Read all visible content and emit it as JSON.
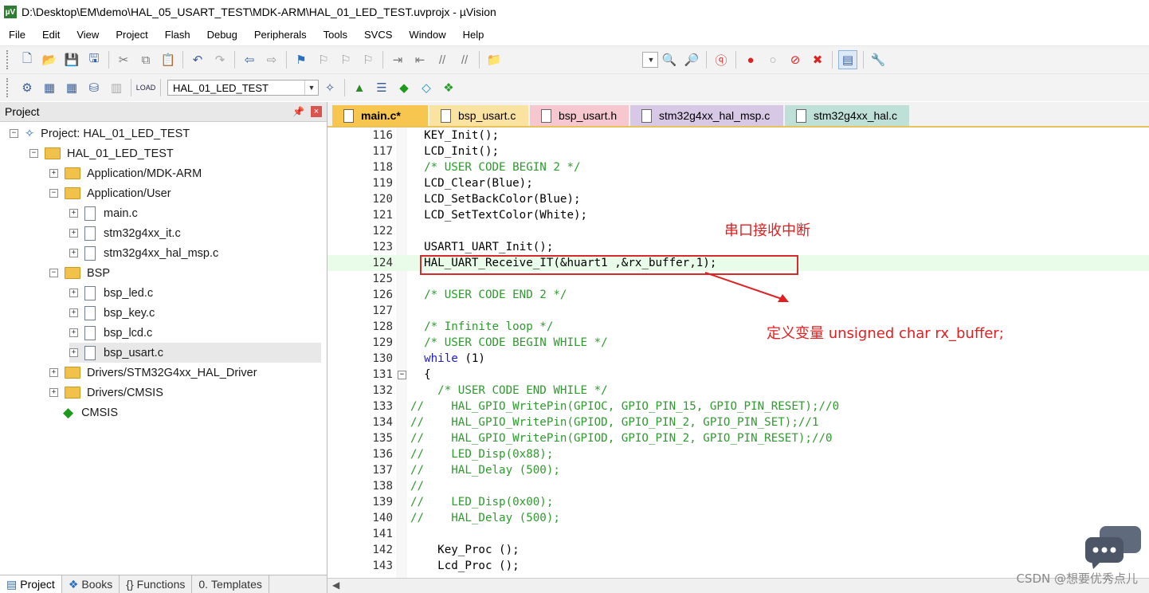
{
  "window": {
    "title": "D:\\Desktop\\EM\\demo\\HAL_05_USART_TEST\\MDK-ARM\\HAL_01_LED_TEST.uvprojx - µVision",
    "app_icon": "uv-logo-icon"
  },
  "menu": [
    "File",
    "Edit",
    "View",
    "Project",
    "Flash",
    "Debug",
    "Peripherals",
    "Tools",
    "SVCS",
    "Window",
    "Help"
  ],
  "toolbar2": {
    "target": "HAL_01_LED_TEST"
  },
  "project_panel": {
    "title": "Project",
    "tree": [
      {
        "label": "Project: HAL_01_LED_TEST",
        "level": 0,
        "expander": "−",
        "icon": "project-icon"
      },
      {
        "label": "HAL_01_LED_TEST",
        "level": 1,
        "expander": "−",
        "icon": "target-folder-icon"
      },
      {
        "label": "Application/MDK-ARM",
        "level": 2,
        "expander": "+",
        "icon": "folder-icon"
      },
      {
        "label": "Application/User",
        "level": 2,
        "expander": "−",
        "icon": "folder-icon"
      },
      {
        "label": "main.c",
        "level": 3,
        "expander": "+",
        "icon": "file-icon"
      },
      {
        "label": "stm32g4xx_it.c",
        "level": 3,
        "expander": "+",
        "icon": "file-icon"
      },
      {
        "label": "stm32g4xx_hal_msp.c",
        "level": 3,
        "expander": "+",
        "icon": "file-icon"
      },
      {
        "label": "BSP",
        "level": 2,
        "expander": "−",
        "icon": "folder-icon"
      },
      {
        "label": "bsp_led.c",
        "level": 3,
        "expander": "+",
        "icon": "file-icon"
      },
      {
        "label": "bsp_key.c",
        "level": 3,
        "expander": "+",
        "icon": "file-icon"
      },
      {
        "label": "bsp_lcd.c",
        "level": 3,
        "expander": "+",
        "icon": "file-icon"
      },
      {
        "label": "bsp_usart.c",
        "level": 3,
        "expander": "+",
        "icon": "file-icon",
        "selected": true
      },
      {
        "label": "Drivers/STM32G4xx_HAL_Driver",
        "level": 2,
        "expander": "+",
        "icon": "folder-icon"
      },
      {
        "label": "Drivers/CMSIS",
        "level": 2,
        "expander": "+",
        "icon": "folder-icon"
      },
      {
        "label": "CMSIS",
        "level": 2,
        "expander": "",
        "icon": "cmsis-diamond-icon"
      }
    ],
    "bottom_tabs": [
      "Project",
      "Books",
      "Functions",
      "Templates"
    ]
  },
  "editor": {
    "tabs": [
      {
        "label": "main.c*",
        "active": true,
        "color": "#f6c64e"
      },
      {
        "label": "bsp_usart.c",
        "active": false,
        "color": "#fae3a0"
      },
      {
        "label": "bsp_usart.h",
        "active": false,
        "color": "#f7c7cf"
      },
      {
        "label": "stm32g4xx_hal_msp.c",
        "active": false,
        "color": "#d7c8e6"
      },
      {
        "label": "stm32g4xx_hal.c",
        "active": false,
        "color": "#bfe0d6"
      }
    ],
    "lines": [
      {
        "num": "116",
        "text": "  KEY_Init();",
        "kind": "code"
      },
      {
        "num": "117",
        "text": "  LCD_Init();",
        "kind": "code"
      },
      {
        "num": "118",
        "text": "  /* USER CODE BEGIN 2 */",
        "kind": "comment"
      },
      {
        "num": "119",
        "text": "  LCD_Clear(Blue);",
        "kind": "code"
      },
      {
        "num": "120",
        "text": "  LCD_SetBackColor(Blue);",
        "kind": "code"
      },
      {
        "num": "121",
        "text": "  LCD_SetTextColor(White);",
        "kind": "code"
      },
      {
        "num": "122",
        "text": "",
        "kind": "code"
      },
      {
        "num": "123",
        "text": "  USART1_UART_Init();",
        "kind": "code"
      },
      {
        "num": "124",
        "text": "  HAL_UART_Receive_IT(&huart1 ,&rx_buffer,1);",
        "kind": "code",
        "highlight": true
      },
      {
        "num": "125",
        "text": "",
        "kind": "code"
      },
      {
        "num": "126",
        "text": "  /* USER CODE END 2 */",
        "kind": "comment"
      },
      {
        "num": "127",
        "text": "",
        "kind": "code"
      },
      {
        "num": "128",
        "text": "  /* Infinite loop */",
        "kind": "comment"
      },
      {
        "num": "129",
        "text": "  /* USER CODE BEGIN WHILE */",
        "kind": "comment"
      },
      {
        "num": "130",
        "text": "  while (1)",
        "kind": "while"
      },
      {
        "num": "131",
        "text": "  {",
        "kind": "code",
        "fold": true
      },
      {
        "num": "132",
        "text": "    /* USER CODE END WHILE */",
        "kind": "comment"
      },
      {
        "num": "133",
        "text": "//    HAL_GPIO_WritePin(GPIOC, GPIO_PIN_15, GPIO_PIN_RESET);//0",
        "kind": "comment"
      },
      {
        "num": "134",
        "text": "//    HAL_GPIO_WritePin(GPIOD, GPIO_PIN_2, GPIO_PIN_SET);//1",
        "kind": "comment"
      },
      {
        "num": "135",
        "text": "//    HAL_GPIO_WritePin(GPIOD, GPIO_PIN_2, GPIO_PIN_RESET);//0",
        "kind": "comment"
      },
      {
        "num": "136",
        "text": "//    LED_Disp(0x88);",
        "kind": "comment"
      },
      {
        "num": "137",
        "text": "//    HAL_Delay (500);",
        "kind": "comment"
      },
      {
        "num": "138",
        "text": "//",
        "kind": "comment"
      },
      {
        "num": "139",
        "text": "//    LED_Disp(0x00);",
        "kind": "comment"
      },
      {
        "num": "140",
        "text": "//    HAL_Delay (500);",
        "kind": "comment"
      },
      {
        "num": "141",
        "text": "",
        "kind": "code"
      },
      {
        "num": "142",
        "text": "    Key_Proc ();",
        "kind": "code"
      },
      {
        "num": "143",
        "text": "    Lcd_Proc ();",
        "kind": "code"
      }
    ]
  },
  "annotations": {
    "label1": "串口接收中断",
    "label2": "定义变量 unsigned char rx_buffer;",
    "color": "#e02020"
  },
  "watermark": "CSDN @想要优秀点儿"
}
